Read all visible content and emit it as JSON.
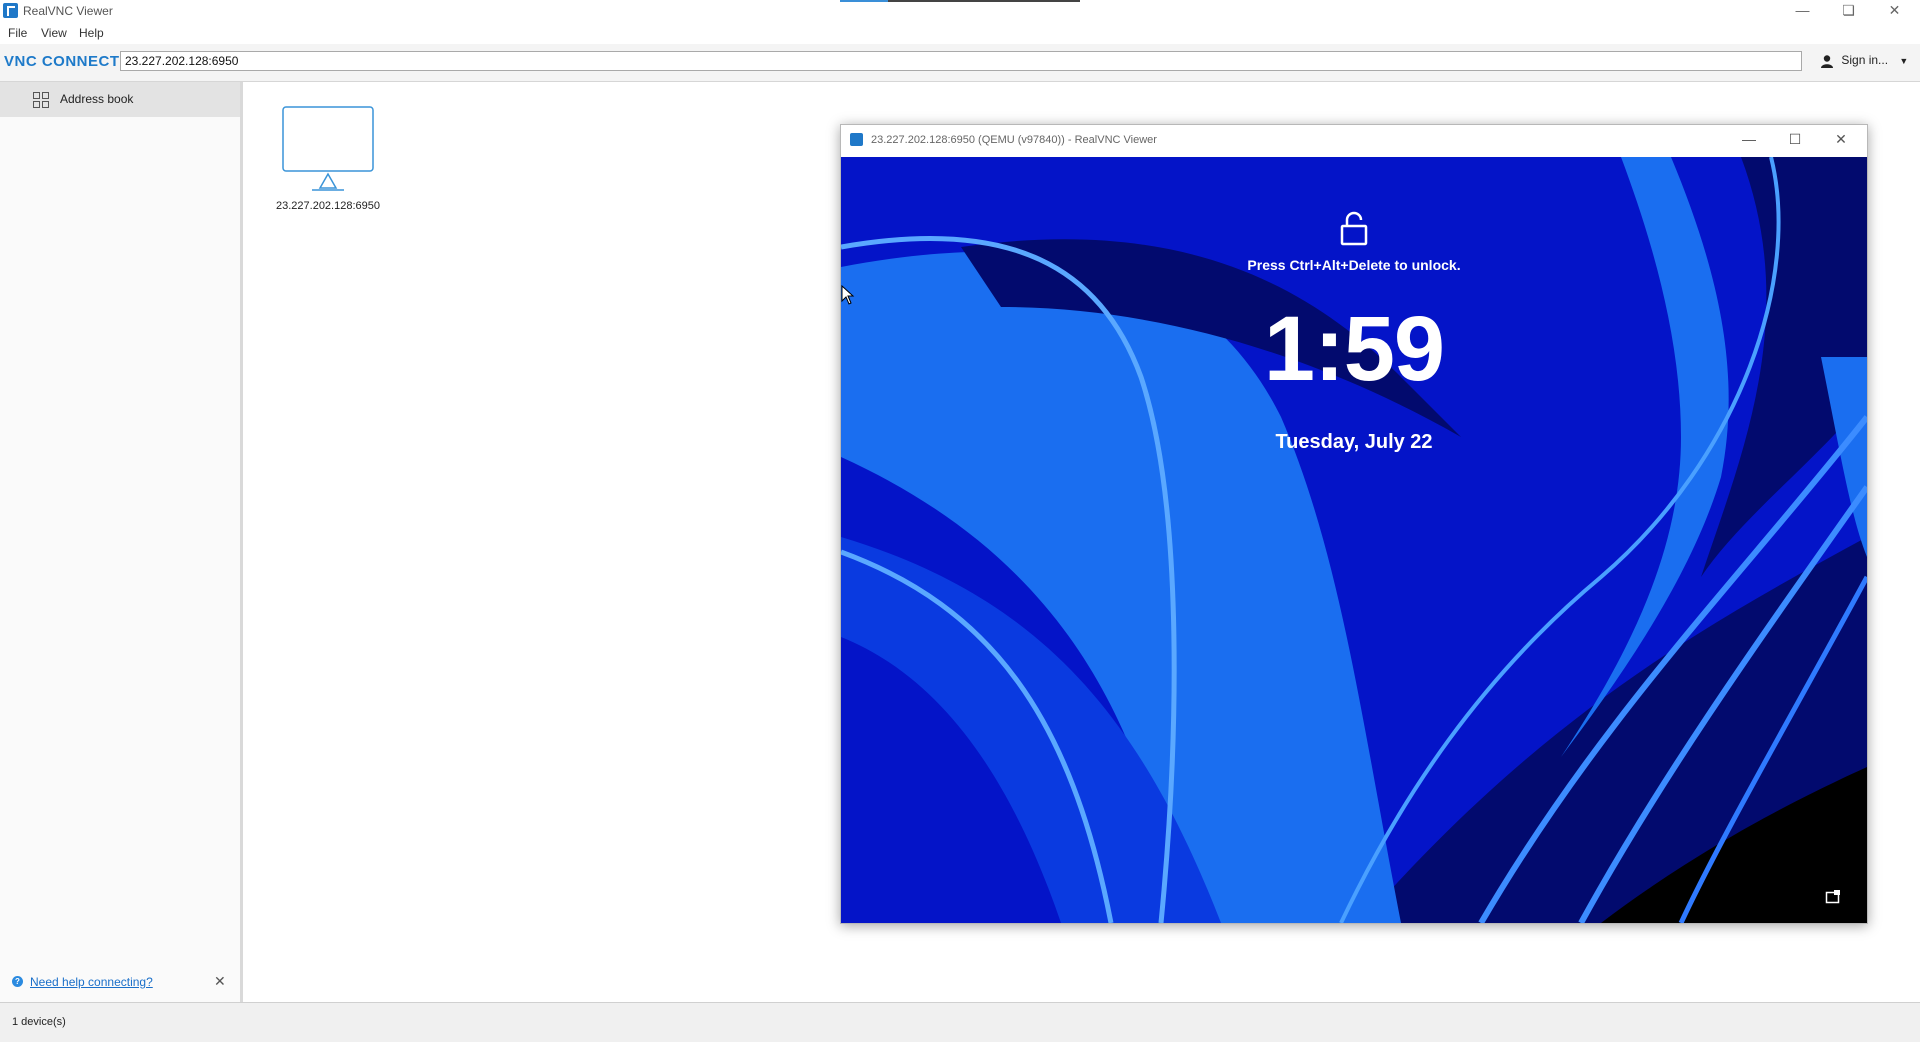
{
  "app": {
    "title": "RealVNC Viewer"
  },
  "menu": {
    "file": "File",
    "view": "View",
    "help": "Help"
  },
  "toolbar": {
    "brand": "VNC CONNECT",
    "address_value": "23.227.202.128:6950",
    "signin_label": "Sign in..."
  },
  "sidebar": {
    "address_book_label": "Address book",
    "help_link": "Need help connecting?"
  },
  "devices": [
    {
      "name": "23.227.202.128:6950"
    }
  ],
  "status": {
    "device_count": "1 device(s)"
  },
  "vnc_window": {
    "title": "23.227.202.128:6950 (QEMU (v97840)) - RealVNC Viewer"
  },
  "lockscreen": {
    "unlock_message": "Press Ctrl+Alt+Delete to unlock.",
    "time": "1:59",
    "date": "Tuesday, July 22"
  },
  "colors": {
    "accent": "#1e7ac9",
    "wallpaper_base": "#0414c8",
    "wallpaper_light": "#1a6ef0",
    "wallpaper_dark": "#020a6e"
  },
  "icons": [
    "app-icon",
    "minimize-icon",
    "restore-icon",
    "close-icon",
    "user-icon",
    "chevron-down-icon",
    "grid-icon",
    "monitor-icon",
    "help-icon",
    "lock-icon",
    "accessibility-icon",
    "mouse-cursor-icon"
  ]
}
